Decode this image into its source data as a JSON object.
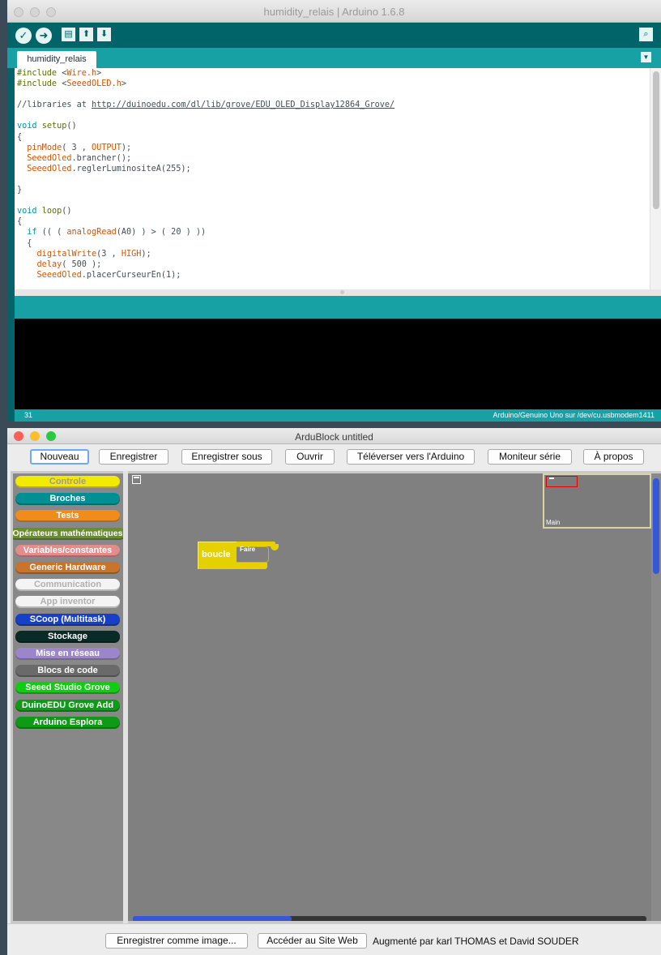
{
  "arduino_ide": {
    "title": "humidity_relais | Arduino 1.6.8",
    "toolbar": {
      "verify_icon": "check-icon",
      "upload_icon": "arrow-right-icon",
      "new_icon": "file-icon",
      "open_icon": "arrow-up-icon",
      "save_icon": "arrow-down-icon",
      "serial_monitor_icon": "magnifier-icon"
    },
    "tab_label": "humidity_relais",
    "code_lines": [
      "#include <Wire.h>",
      "#include <SeeedOLED.h>",
      "",
      "//libraries at http://duinoedu.com/dl/lib/grove/EDU_OLED_Display12864_Grove/",
      "",
      "void setup()",
      "{",
      "  pinMode( 3 , OUTPUT);",
      "  SeeedOled.brancher();",
      "  SeeedOled.reglerLuminositeA(255);",
      "",
      "}",
      "",
      "void loop()",
      "{",
      "  if (( ( analogRead(A0) ) > ( 20 ) ))",
      "  {",
      "    digitalWrite(3 , HIGH);",
      "    delay( 500 );",
      "    SeeedOled.placerCurseurEn(1);"
    ],
    "status_line": "31",
    "status_board": "Arduino/Genuino Uno sur /dev/cu.usbmodem1411",
    "colors": {
      "toolbar": "#006468",
      "accent": "#17a1a5"
    }
  },
  "ardublock": {
    "title": "ArduBlock untitled",
    "buttons": {
      "nouveau": "Nouveau",
      "enregistrer": "Enregistrer",
      "enregistrer_sous": "Enregistrer sous",
      "ouvrir": "Ouvrir",
      "televerser": "Téléverser vers l'Arduino",
      "moniteur": "Moniteur série",
      "apropos": "À propos"
    },
    "categories": [
      {
        "label": "Controle",
        "color": "#f2ea00",
        "text": "#9a9a9a"
      },
      {
        "label": "Broches",
        "color": "#008f93",
        "text": "#ffffff"
      },
      {
        "label": "Tests",
        "color": "#f08c1a",
        "text": "#ffffff"
      },
      {
        "label": "Opérateurs mathématiques",
        "color": "#6a8e2a",
        "text": "#ffffff"
      },
      {
        "label": "Variables/constantes",
        "color": "#e38c8c",
        "text": "#ffffff"
      },
      {
        "label": "Generic Hardware",
        "color": "#c8742a",
        "text": "#ffffff"
      },
      {
        "label": "Communication",
        "color": "#f4f4f4",
        "text": "#b0b0b0"
      },
      {
        "label": "App inventor",
        "color": "#f4f4f4",
        "text": "#b0b0b0"
      },
      {
        "label": "SCoop (Multitask)",
        "color": "#1640c8",
        "text": "#ffffff"
      },
      {
        "label": "Stockage",
        "color": "#0a2a25",
        "text": "#ffffff"
      },
      {
        "label": "Mise en réseau",
        "color": "#9b86cc",
        "text": "#ffffff"
      },
      {
        "label": "Blocs de code",
        "color": "#6a6a6a",
        "text": "#ffffff"
      },
      {
        "label": "Seeed Studio Grove",
        "color": "#12cc12",
        "text": "#ffffff"
      },
      {
        "label": "DuinoEDU Grove Add",
        "color": "#0e9a16",
        "text": "#ffffff"
      },
      {
        "label": "Arduino Esplora",
        "color": "#0e9a16",
        "text": "#ffffff"
      }
    ],
    "block": {
      "label": "boucle",
      "slot": "Faire",
      "color": "#e5d100"
    },
    "minimap_label": "Main",
    "footer": {
      "save_image": "Enregistrer comme image...",
      "site": "Accéder au Site Web",
      "credit": "Augmenté par karl THOMAS et David SOUDER"
    }
  }
}
